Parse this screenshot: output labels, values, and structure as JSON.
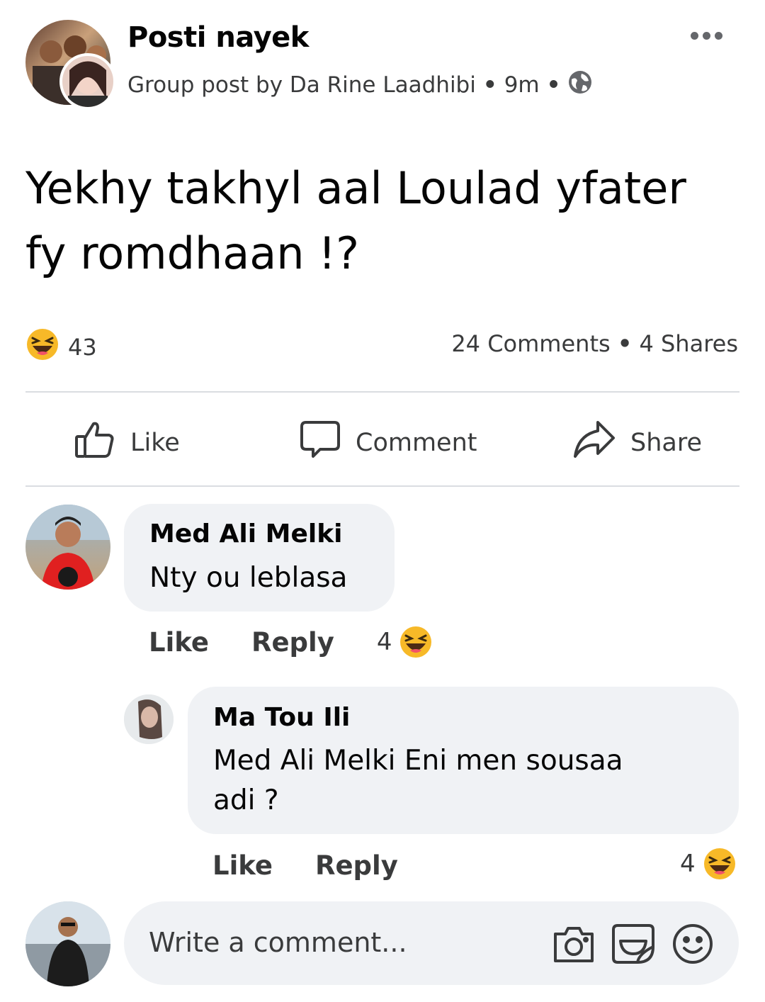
{
  "post": {
    "group_name": "Posti nayek",
    "subtitle": "Group post by Da Rine Laadhibi",
    "time": "9m",
    "dot": "•",
    "privacy_icon": "globe-icon",
    "more_icon": "more-options-icon",
    "text": "Yekhy takhyl aal Loulad yfater fy romdhaan !?",
    "reaction_icon": "haha-emoji-icon",
    "reaction_count": "43",
    "comments_count": "24 Comments",
    "shares_count": "4 Shares"
  },
  "actions": {
    "like": "Like",
    "comment": "Comment",
    "share": "Share"
  },
  "comments": [
    {
      "name": "Med Ali Melki",
      "text": "Nty ou leblasa",
      "like": "Like",
      "reply": "Reply",
      "reaction_count": "4"
    },
    {
      "name": "Ma Tou Ili",
      "text_line1": "Med Ali Melki Eni men sousaa",
      "text_line2": "adi ?",
      "like": "Like",
      "reply": "Reply",
      "reaction_count": "4"
    }
  ],
  "composer": {
    "placeholder": "Write a comment...",
    "icons": [
      "camera-icon",
      "gif-sticker-icon",
      "smiley-icon"
    ]
  },
  "colors": {
    "text": "#050505",
    "secondary": "#3a3b3c",
    "bubble": "#f0f2f5",
    "divider": "#dadde1",
    "emoji_yellow": "#f7b928"
  }
}
